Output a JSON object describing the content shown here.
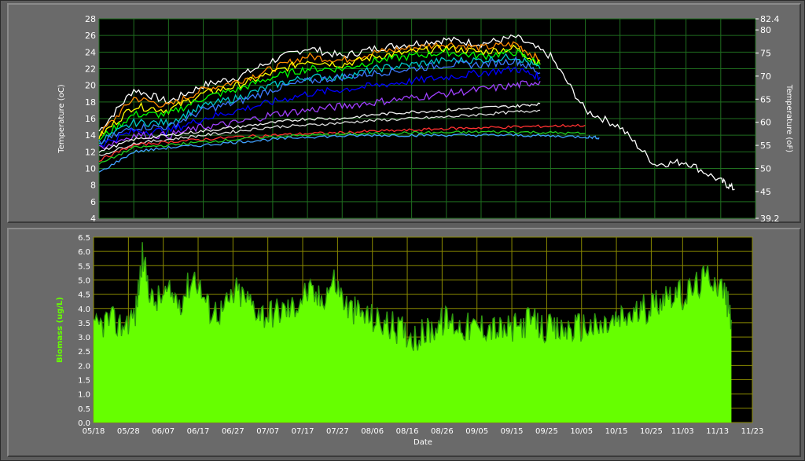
{
  "chart_data": [
    {
      "type": "line",
      "ylabel": "Temperature (oC)",
      "y2label": "Temperature (oF)",
      "ylim": [
        4,
        28
      ],
      "y_ticks": [
        4,
        6,
        8,
        10,
        12,
        14,
        16,
        18,
        20,
        22,
        24,
        26,
        28
      ],
      "y2_ticks": [
        39.2,
        45,
        50,
        55,
        60,
        65,
        70,
        75,
        80,
        82.4
      ],
      "x_range": [
        "05/18",
        "11/23"
      ],
      "grid": true,
      "background": "#000000",
      "grid_color": "#1f6e1f",
      "series": [
        {
          "color": "#ffffff",
          "x": [
            "05/18",
            "05/28",
            "06/07",
            "06/17",
            "06/27",
            "07/07",
            "07/17",
            "07/27",
            "08/06",
            "08/16",
            "08/26",
            "09/05",
            "09/15",
            "09/25",
            "10/05",
            "10/15",
            "10/25",
            "11/03",
            "11/13",
            "11/17"
          ],
          "values": [
            14.5,
            19.5,
            18,
            20,
            21,
            23,
            24.5,
            23.5,
            24.5,
            25,
            25.5,
            25,
            25.8,
            23.5,
            17,
            15,
            10.5,
            10.8,
            8.5,
            7.5
          ]
        },
        {
          "color": "#ff8c00",
          "x": [
            "05/18",
            "05/28",
            "06/07",
            "06/17",
            "06/27",
            "07/07",
            "07/17",
            "07/27",
            "08/06",
            "08/16",
            "08/26",
            "09/05",
            "09/15",
            "09/22"
          ],
          "values": [
            14,
            18.5,
            17.5,
            19.5,
            20.5,
            22,
            23.5,
            23,
            24,
            24.5,
            25,
            24.5,
            25,
            23
          ]
        },
        {
          "color": "#ffff00",
          "x": [
            "05/18",
            "05/28",
            "06/07",
            "06/17",
            "06/27",
            "07/07",
            "07/17",
            "07/27",
            "08/06",
            "08/16",
            "08/26",
            "09/05",
            "09/15",
            "09/22"
          ],
          "values": [
            13.8,
            17.5,
            17,
            19,
            20,
            21.5,
            23,
            22.5,
            23.5,
            24,
            24.5,
            24,
            24.5,
            22.5
          ]
        },
        {
          "color": "#00ff00",
          "x": [
            "05/18",
            "05/28",
            "06/07",
            "06/17",
            "06/27",
            "07/07",
            "07/17",
            "07/27",
            "08/06",
            "08/16",
            "08/26",
            "09/05",
            "09/15",
            "09/22"
          ],
          "values": [
            13.5,
            16.5,
            16.5,
            18.5,
            19.5,
            21,
            22,
            22,
            23,
            23.5,
            24,
            23.5,
            24,
            22.5
          ]
        },
        {
          "color": "#00c8c8",
          "x": [
            "05/18",
            "05/28",
            "06/07",
            "06/17",
            "06/27",
            "07/07",
            "07/17",
            "07/27",
            "08/06",
            "08/16",
            "08/26",
            "09/05",
            "09/15",
            "09/22"
          ],
          "values": [
            13.2,
            15.5,
            15.5,
            17.5,
            18.5,
            20,
            21,
            21,
            22,
            22.5,
            23,
            23,
            23.5,
            22
          ]
        },
        {
          "color": "#3c78ff",
          "x": [
            "05/18",
            "05/28",
            "06/07",
            "06/17",
            "06/27",
            "07/07",
            "07/17",
            "07/27",
            "08/06",
            "08/16",
            "08/26",
            "09/05",
            "09/15",
            "09/22"
          ],
          "values": [
            13,
            15,
            15,
            17,
            18,
            19.5,
            20.5,
            21,
            21.5,
            22,
            22.5,
            22.5,
            23,
            21.5
          ]
        },
        {
          "color": "#0000ff",
          "x": [
            "05/18",
            "05/28",
            "06/07",
            "06/17",
            "06/27",
            "07/07",
            "07/17",
            "07/27",
            "08/06",
            "08/16",
            "08/26",
            "09/05",
            "09/15",
            "09/22"
          ],
          "values": [
            12.8,
            14.5,
            14.5,
            16,
            17,
            18,
            19,
            19.5,
            20,
            20.5,
            21,
            21.5,
            22,
            21
          ]
        },
        {
          "color": "#a040ff",
          "x": [
            "05/18",
            "05/28",
            "06/07",
            "06/17",
            "06/27",
            "07/07",
            "07/17",
            "07/27",
            "08/06",
            "08/16",
            "08/26",
            "09/05",
            "09/15",
            "09/22"
          ],
          "values": [
            12.5,
            14,
            14,
            15,
            15.5,
            16.5,
            17,
            17.5,
            18,
            18.5,
            19,
            19.5,
            20,
            20.5
          ]
        },
        {
          "color": "#f0f0f0",
          "x": [
            "05/18",
            "05/28",
            "06/07",
            "06/17",
            "06/27",
            "07/07",
            "07/17",
            "07/27",
            "08/06",
            "08/16",
            "08/26",
            "09/05",
            "09/15",
            "09/22"
          ],
          "values": [
            12,
            13.5,
            14,
            14.5,
            15,
            15.5,
            16,
            16,
            16.5,
            16.8,
            17,
            17.3,
            17.5,
            17.8
          ]
        },
        {
          "color": "#dddddd",
          "x": [
            "05/18",
            "05/28",
            "06/07",
            "06/17",
            "06/27",
            "07/07",
            "07/17",
            "07/27",
            "08/06",
            "08/16",
            "08/26",
            "09/05",
            "09/15",
            "09/22"
          ],
          "values": [
            11.5,
            13,
            13.5,
            14,
            14.5,
            15,
            15.2,
            15.5,
            15.8,
            16,
            16.2,
            16.5,
            16.8,
            17
          ]
        },
        {
          "color": "#ff3030",
          "x": [
            "05/18",
            "05/28",
            "06/07",
            "06/17",
            "06/27",
            "07/07",
            "07/17",
            "07/27",
            "08/06",
            "08/16",
            "08/26",
            "09/05",
            "09/15",
            "09/25",
            "10/05"
          ],
          "values": [
            11,
            12.8,
            13.2,
            13.5,
            13.8,
            14,
            14.2,
            14.3,
            14.5,
            14.6,
            14.8,
            14.9,
            15,
            15.1,
            15.2
          ]
        },
        {
          "color": "#20d020",
          "x": [
            "05/18",
            "05/28",
            "06/07",
            "06/17",
            "06/27",
            "07/07",
            "07/17",
            "07/27",
            "08/06",
            "08/16",
            "08/26",
            "09/05",
            "09/15",
            "09/25",
            "10/05"
          ],
          "values": [
            10.5,
            12.5,
            12.8,
            13.2,
            13.5,
            13.8,
            14,
            14.1,
            14.2,
            14.3,
            14.3,
            14.4,
            14.4,
            14.3,
            14.2
          ]
        },
        {
          "color": "#40a0ff",
          "x": [
            "05/18",
            "05/28",
            "06/07",
            "06/17",
            "06/27",
            "07/07",
            "07/17",
            "07/27",
            "08/06",
            "08/16",
            "08/26",
            "09/05",
            "09/15",
            "09/25",
            "10/05",
            "10/09"
          ],
          "values": [
            9.5,
            12,
            12.5,
            12.8,
            13.2,
            13.5,
            13.8,
            13.9,
            14,
            14,
            14,
            14,
            14,
            13.9,
            13.8,
            13.7
          ]
        }
      ]
    },
    {
      "type": "area",
      "ylabel": "Biomass (ug/L)",
      "xlabel": "Date",
      "ylim": [
        0,
        6.5
      ],
      "y_ticks": [
        0.0,
        0.5,
        1.0,
        1.5,
        2.0,
        2.5,
        3.0,
        3.5,
        4.0,
        4.5,
        5.0,
        5.5,
        6.0,
        6.5
      ],
      "x_ticks": [
        "05/18",
        "05/28",
        "06/07",
        "06/17",
        "06/27",
        "07/07",
        "07/17",
        "07/27",
        "08/06",
        "08/16",
        "08/26",
        "09/05",
        "09/15",
        "09/25",
        "10/05",
        "10/15",
        "10/25",
        "11/03",
        "11/13",
        "11/23"
      ],
      "grid": true,
      "fill_color": "#66ff00",
      "line_color": "#2f9a10",
      "background": "#000000",
      "grid_color": "#8a8a00",
      "x": [
        "05/18",
        "05/22",
        "05/26",
        "05/30",
        "06/01",
        "06/04",
        "06/08",
        "06/12",
        "06/16",
        "06/20",
        "06/24",
        "06/28",
        "07/02",
        "07/06",
        "07/10",
        "07/14",
        "07/18",
        "07/22",
        "07/26",
        "07/30",
        "08/03",
        "08/07",
        "08/11",
        "08/15",
        "08/19",
        "08/23",
        "08/27",
        "08/31",
        "09/04",
        "09/08",
        "09/12",
        "09/16",
        "09/20",
        "09/24",
        "09/28",
        "10/02",
        "10/06",
        "10/10",
        "10/14",
        "10/18",
        "10/22",
        "10/26",
        "10/30",
        "11/03",
        "11/07",
        "11/11",
        "11/15",
        "11/17"
      ],
      "values": [
        3.2,
        3.6,
        3.4,
        3.8,
        5.8,
        4.2,
        4.5,
        4.3,
        5.2,
        4.0,
        3.9,
        4.6,
        4.2,
        3.8,
        3.9,
        4.0,
        4.6,
        4.3,
        5.0,
        4.0,
        3.8,
        3.6,
        3.4,
        3.2,
        3.0,
        3.3,
        3.6,
        3.4,
        3.3,
        3.4,
        3.2,
        3.3,
        3.6,
        3.3,
        3.2,
        3.3,
        3.4,
        3.3,
        3.5,
        3.7,
        3.9,
        4.2,
        4.6,
        4.4,
        4.8,
        5.2,
        4.6,
        3.6
      ]
    }
  ]
}
